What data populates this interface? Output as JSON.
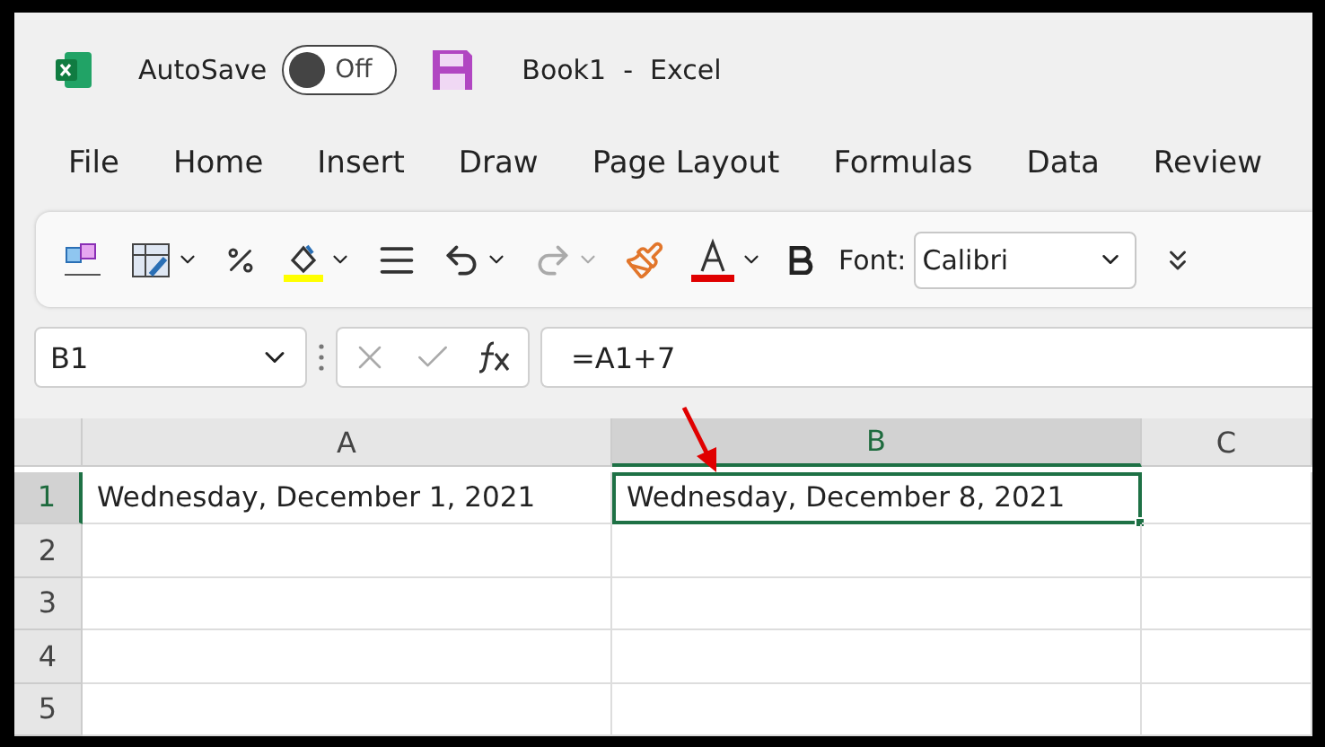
{
  "title_bar": {
    "autosave_label": "AutoSave",
    "autosave": {
      "on": false,
      "label": "Off"
    },
    "title": "Book1  -  Excel"
  },
  "menu_tabs": [
    "File",
    "Home",
    "Insert",
    "Draw",
    "Page Layout",
    "Formulas",
    "Data",
    "Review"
  ],
  "ribbon": {
    "font_label": "Font:",
    "font_value": "Calibri"
  },
  "formula_bar": {
    "name_box": "B1",
    "formula": "=A1+7"
  },
  "sheet": {
    "columns": [
      {
        "label": "A",
        "selected": false
      },
      {
        "label": "B",
        "selected": true
      },
      {
        "label": "C",
        "selected": false
      }
    ],
    "rows": [
      {
        "label": "1",
        "selected": true,
        "cells": [
          {
            "value": "Wednesday, December 1, 2021",
            "selected": false
          },
          {
            "value": "Wednesday, December 8, 2021",
            "selected": true
          }
        ]
      },
      {
        "label": "2",
        "selected": false
      },
      {
        "label": "3",
        "selected": false
      },
      {
        "label": "4",
        "selected": false
      },
      {
        "label": "5",
        "selected": false
      }
    ]
  }
}
